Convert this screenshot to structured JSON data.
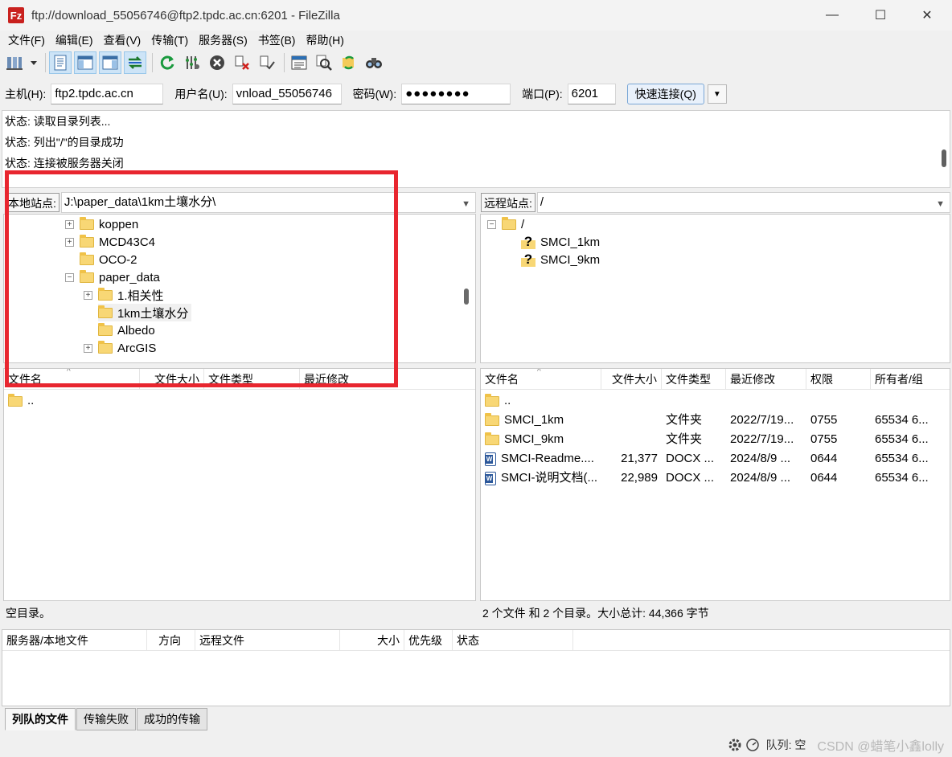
{
  "window": {
    "title": "ftp://download_55056746@ftp2.tpdc.ac.cn:6201 - FileZilla",
    "app_logo": "Fz",
    "minimize": "—",
    "maximize": "☐",
    "close": "✕"
  },
  "menu": [
    "文件(F)",
    "编辑(E)",
    "查看(V)",
    "传输(T)",
    "服务器(S)",
    "书签(B)",
    "帮助(H)"
  ],
  "toolbar": {
    "icons": [
      "site-manager-icon",
      "dropdown-arrow-icon",
      "toggle-log-icon",
      "toggle-local-tree-icon",
      "toggle-remote-tree-icon",
      "toggle-queue-icon",
      "refresh-icon",
      "process-queue-icon",
      "cancel-icon",
      "disconnect-icon",
      "reconnect-icon",
      "directory-listing-filter-icon",
      "compare-icon",
      "sync-browse-icon",
      "search-icon"
    ]
  },
  "quickconnect": {
    "host_label": "主机(H):",
    "host_value": "ftp2.tpdc.ac.cn",
    "user_label": "用户名(U):",
    "user_value": "vnload_55056746",
    "pass_label": "密码(W):",
    "pass_value": "●●●●●●●●",
    "port_label": "端口(P):",
    "port_value": "6201",
    "connect_label": "快速连接(Q)",
    "drop_arrow": "▼"
  },
  "log": [
    "状态:  读取目录列表...",
    "状态:  列出\"/\"的目录成功",
    "状态:  连接被服务器关闭"
  ],
  "local": {
    "site_label": "本地站点:",
    "path": "J:\\paper_data\\1km土壤水分\\",
    "tree": [
      {
        "label": "koppen",
        "expander": "+"
      },
      {
        "label": "MCD43C4",
        "expander": "+"
      },
      {
        "label": "OCO-2",
        "expander": ""
      },
      {
        "label": "paper_data",
        "expander": "−"
      },
      {
        "label": "1.相关性",
        "expander": "+"
      },
      {
        "label": "1km土壤水分",
        "expander": ""
      },
      {
        "label": "Albedo",
        "expander": ""
      },
      {
        "label": "ArcGIS",
        "expander": "+"
      }
    ],
    "columns": [
      "文件名",
      "文件大小",
      "文件类型",
      "最近修改"
    ],
    "rows": [
      {
        "name": ".."
      }
    ],
    "status": "空目录。"
  },
  "remote": {
    "site_label": "远程站点:",
    "path": "/",
    "tree": [
      {
        "label": "/",
        "expander": "−"
      },
      {
        "label": "SMCI_1km",
        "expander": ""
      },
      {
        "label": "SMCI_9km",
        "expander": ""
      }
    ],
    "unknown_glyph": "?",
    "columns": [
      "文件名",
      "文件大小",
      "文件类型",
      "最近修改",
      "权限",
      "所有者/组"
    ],
    "rows": [
      {
        "name": "..",
        "size": "",
        "type": "",
        "modified": "",
        "perm": "",
        "owner": "",
        "icon": "folder"
      },
      {
        "name": "SMCI_1km",
        "size": "",
        "type": "文件夹",
        "modified": "2022/7/19...",
        "perm": "0755",
        "owner": "65534 6...",
        "icon": "folder"
      },
      {
        "name": "SMCI_9km",
        "size": "",
        "type": "文件夹",
        "modified": "2022/7/19...",
        "perm": "0755",
        "owner": "65534 6...",
        "icon": "folder"
      },
      {
        "name": "SMCI-Readme....",
        "size": "21,377",
        "type": "DOCX ...",
        "modified": "2024/8/9 ...",
        "perm": "0644",
        "owner": "65534 6...",
        "icon": "docx"
      },
      {
        "name": "SMCI-说明文档(...",
        "size": "22,989",
        "type": "DOCX ...",
        "modified": "2024/8/9 ...",
        "perm": "0644",
        "owner": "65534 6...",
        "icon": "docx"
      }
    ],
    "status": "2 个文件 和 2 个目录。大小总计: 44,366 字节"
  },
  "queue": {
    "columns": [
      "服务器/本地文件",
      "方向",
      "远程文件",
      "大小",
      "优先级",
      "状态"
    ]
  },
  "tabs": [
    "列队的文件",
    "传输失败",
    "成功的传输"
  ],
  "statusbar": {
    "queue_label": "队列: 空",
    "watermark": "CSDN @蜡笔小鑫lolly"
  },
  "colors": {
    "highlight_box": "#e8262f",
    "folder": "#f8d775",
    "docx": "#2b579a"
  }
}
